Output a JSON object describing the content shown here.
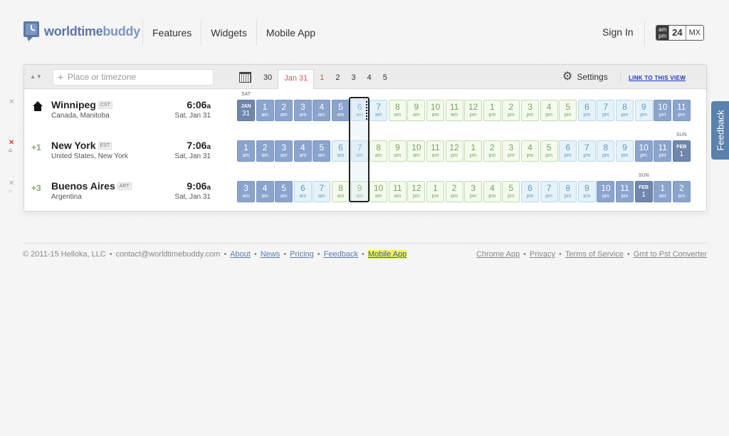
{
  "header": {
    "logo_a": "worldtime",
    "logo_b": "buddy",
    "nav": [
      "Features",
      "Widgets",
      "Mobile App"
    ],
    "signin": "Sign In",
    "format": {
      "ampm_top": "am",
      "ampm_bottom": "pm",
      "h24": "24",
      "mx": "MX"
    }
  },
  "toolbar": {
    "search_placeholder": "Place or timezone",
    "day_tabs": [
      "30",
      "Jan 31",
      "1",
      "2",
      "3",
      "4",
      "5"
    ],
    "settings": "Settings",
    "link_view": "LINK TO THIS VIEW"
  },
  "rows": [
    {
      "offset": "",
      "city": "Winnipeg",
      "tz": "CST",
      "region": "Canada, Manitoba",
      "time": "6:06",
      "suffix": "a",
      "date": "Sat, Jan 31",
      "day_label": "SAT",
      "hours": [
        {
          "k": "date",
          "m": "JAN",
          "d": "31"
        },
        {
          "k": "night",
          "n": "1",
          "s": "am"
        },
        {
          "k": "night",
          "n": "2",
          "s": "am"
        },
        {
          "k": "night",
          "n": "3",
          "s": "am"
        },
        {
          "k": "night",
          "n": "4",
          "s": "am"
        },
        {
          "k": "night",
          "n": "5",
          "s": "am"
        },
        {
          "k": "morn",
          "n": "6",
          "s": "am"
        },
        {
          "k": "morn",
          "n": "7",
          "s": "am"
        },
        {
          "k": "day",
          "n": "8",
          "s": "am"
        },
        {
          "k": "day",
          "n": "9",
          "s": "am"
        },
        {
          "k": "day",
          "n": "10",
          "s": "am"
        },
        {
          "k": "day",
          "n": "11",
          "s": "am"
        },
        {
          "k": "day",
          "n": "12",
          "s": "pm"
        },
        {
          "k": "day",
          "n": "1",
          "s": "pm"
        },
        {
          "k": "day",
          "n": "2",
          "s": "pm"
        },
        {
          "k": "day",
          "n": "3",
          "s": "pm"
        },
        {
          "k": "day",
          "n": "4",
          "s": "pm"
        },
        {
          "k": "day",
          "n": "5",
          "s": "pm"
        },
        {
          "k": "eve",
          "n": "6",
          "s": "pm"
        },
        {
          "k": "eve",
          "n": "7",
          "s": "pm"
        },
        {
          "k": "eve",
          "n": "8",
          "s": "pm"
        },
        {
          "k": "eve",
          "n": "9",
          "s": "pm"
        },
        {
          "k": "night",
          "n": "10",
          "s": "pm"
        },
        {
          "k": "night",
          "n": "11",
          "s": "pm"
        }
      ]
    },
    {
      "offset": "+1",
      "city": "New York",
      "tz": "EST",
      "region": "United States, New York",
      "time": "7:06",
      "suffix": "a",
      "date": "Sat, Jan 31",
      "day_label": "SUN",
      "hours": [
        {
          "k": "night",
          "n": "1",
          "s": "am"
        },
        {
          "k": "night",
          "n": "2",
          "s": "am"
        },
        {
          "k": "night",
          "n": "3",
          "s": "am"
        },
        {
          "k": "night",
          "n": "4",
          "s": "am"
        },
        {
          "k": "night",
          "n": "5",
          "s": "am"
        },
        {
          "k": "morn",
          "n": "6",
          "s": "am"
        },
        {
          "k": "morn",
          "n": "7",
          "s": "am"
        },
        {
          "k": "day",
          "n": "8",
          "s": "am"
        },
        {
          "k": "day",
          "n": "9",
          "s": "am"
        },
        {
          "k": "day",
          "n": "10",
          "s": "am"
        },
        {
          "k": "day",
          "n": "11",
          "s": "am"
        },
        {
          "k": "day",
          "n": "12",
          "s": "pm"
        },
        {
          "k": "day",
          "n": "1",
          "s": "pm"
        },
        {
          "k": "day",
          "n": "2",
          "s": "pm"
        },
        {
          "k": "day",
          "n": "3",
          "s": "pm"
        },
        {
          "k": "day",
          "n": "4",
          "s": "pm"
        },
        {
          "k": "day",
          "n": "5",
          "s": "pm"
        },
        {
          "k": "eve",
          "n": "6",
          "s": "pm"
        },
        {
          "k": "eve",
          "n": "7",
          "s": "pm"
        },
        {
          "k": "eve",
          "n": "8",
          "s": "pm"
        },
        {
          "k": "eve",
          "n": "9",
          "s": "pm"
        },
        {
          "k": "night",
          "n": "10",
          "s": "pm"
        },
        {
          "k": "night",
          "n": "11",
          "s": "pm"
        },
        {
          "k": "date",
          "m": "FEB",
          "d": "1"
        }
      ]
    },
    {
      "offset": "+3",
      "city": "Buenos Aires",
      "tz": "ART",
      "region": "Argentina",
      "time": "9:06",
      "suffix": "a",
      "date": "Sat, Jan 31",
      "day_label": "SUN",
      "hours": [
        {
          "k": "night",
          "n": "3",
          "s": "am"
        },
        {
          "k": "night",
          "n": "4",
          "s": "am"
        },
        {
          "k": "night",
          "n": "5",
          "s": "am"
        },
        {
          "k": "morn",
          "n": "6",
          "s": "am"
        },
        {
          "k": "morn",
          "n": "7",
          "s": "am"
        },
        {
          "k": "day",
          "n": "8",
          "s": "am"
        },
        {
          "k": "day",
          "n": "9",
          "s": "am"
        },
        {
          "k": "day",
          "n": "10",
          "s": "am"
        },
        {
          "k": "day",
          "n": "11",
          "s": "am"
        },
        {
          "k": "day",
          "n": "12",
          "s": "pm"
        },
        {
          "k": "day",
          "n": "1",
          "s": "pm"
        },
        {
          "k": "day",
          "n": "2",
          "s": "pm"
        },
        {
          "k": "day",
          "n": "3",
          "s": "pm"
        },
        {
          "k": "day",
          "n": "4",
          "s": "pm"
        },
        {
          "k": "day",
          "n": "5",
          "s": "pm"
        },
        {
          "k": "eve",
          "n": "6",
          "s": "pm"
        },
        {
          "k": "eve",
          "n": "7",
          "s": "pm"
        },
        {
          "k": "eve",
          "n": "8",
          "s": "pm"
        },
        {
          "k": "eve",
          "n": "9",
          "s": "pm"
        },
        {
          "k": "night",
          "n": "10",
          "s": "pm"
        },
        {
          "k": "night",
          "n": "11",
          "s": "pm"
        },
        {
          "k": "date",
          "m": "FEB",
          "d": "1"
        },
        {
          "k": "night",
          "n": "1",
          "s": "am"
        },
        {
          "k": "night",
          "n": "2",
          "s": "am"
        }
      ]
    }
  ],
  "feedback": "Feedback",
  "footer": {
    "copyright": "© 2011-15 Helloka, LLC",
    "contact": "contact@worldtimebuddy.com",
    "left_links": [
      "About",
      "News",
      "Pricing",
      "Feedback",
      "Mobile App"
    ],
    "right_links": [
      "Chrome App",
      "Privacy",
      "Terms of Service",
      "Gmt to Pst Converter"
    ]
  },
  "colors": {
    "night": "#8aa4ce",
    "morning": "#e5f2f8",
    "day": "#f4faed",
    "date_cell": "#6f87ae",
    "brand": "#5a78a8",
    "feedback_tab": "#5a82ad"
  }
}
